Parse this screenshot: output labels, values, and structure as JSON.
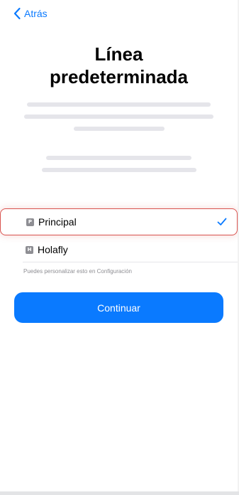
{
  "nav": {
    "back_label": "Atrás",
    "back_icon": "chevron-left-icon"
  },
  "title": {
    "line1": "Línea",
    "line2": "predeterminada"
  },
  "options": [
    {
      "badge": "P",
      "label": "Principal",
      "selected": true
    },
    {
      "badge": "H",
      "label": "Holafly",
      "selected": false
    }
  ],
  "hint": "Puedes personalizar esto en Configuración",
  "continue_label": "Continuar",
  "colors": {
    "accent": "#0a7aff",
    "highlight_border": "#d9534f",
    "placeholder": "#e5e5ea",
    "badge": "#8e8e93"
  }
}
